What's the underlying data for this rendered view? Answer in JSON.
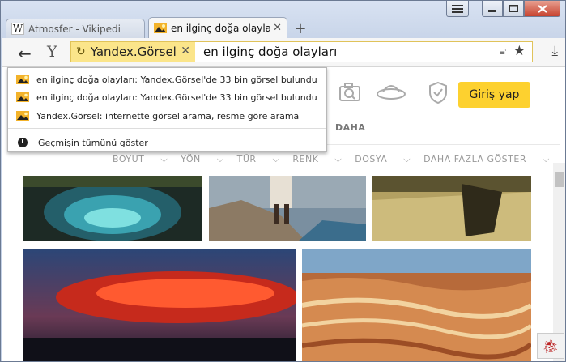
{
  "tabs": [
    {
      "title": "Atmosfer - Vikipedi",
      "favicon": "wikipedia-icon"
    },
    {
      "title": "en ilginç doğa olayları",
      "favicon": "image-icon"
    }
  ],
  "toolbar": {
    "site_chip": "Yandex.Görsel",
    "query": "en ilginç doğa olayları"
  },
  "suggestions": [
    {
      "text": "en ilginç doğa olayları: Yandex.Görsel'de 33 bin görsel bulundu",
      "icon": "image-icon"
    },
    {
      "text": "en ilginç doğa olayları: Yandex.Görsel'de 33 bin görsel bulundu",
      "icon": "image-icon"
    },
    {
      "text": "Yandex.Görsel: internette görsel arama, resme göre arama",
      "icon": "image-icon"
    }
  ],
  "history_link": "Geçmişin tümünü göster",
  "page": {
    "login_label": "Giriş yap",
    "daha_label": "DAHA",
    "filters": [
      "BOYUT",
      "YÖN",
      "TÜR",
      "RENK",
      "DOSYA",
      "DAHA FAZLA GÖSTER"
    ]
  },
  "colors": {
    "accent_yellow": "#fdd12f",
    "chip_yellow": "#fbe58a"
  }
}
